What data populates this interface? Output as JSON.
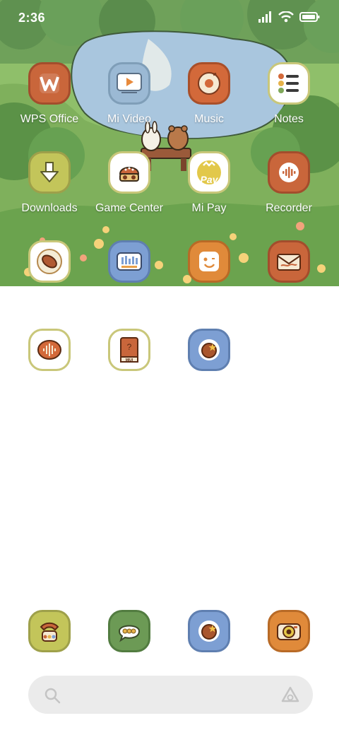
{
  "status": {
    "time": "2:36"
  },
  "apps": [
    {
      "label": "WPS Office",
      "icon": "wps-office-icon"
    },
    {
      "label": "Mi Video",
      "icon": "mi-video-icon"
    },
    {
      "label": "Music",
      "icon": "music-icon"
    },
    {
      "label": "Notes",
      "icon": "notes-icon"
    },
    {
      "label": "Downloads",
      "icon": "downloads-icon"
    },
    {
      "label": "Game Center",
      "icon": "game-center-icon"
    },
    {
      "label": "Mi Pay",
      "icon": "mi-pay-icon",
      "badge_text": "Pay"
    },
    {
      "label": "Recorder",
      "icon": "recorder-icon"
    },
    {
      "label": "",
      "icon": "bean-icon"
    },
    {
      "label": "",
      "icon": "equalizer-icon"
    },
    {
      "label": "",
      "icon": "smiley-icon"
    },
    {
      "label": "",
      "icon": "envelope-icon"
    },
    {
      "label": "",
      "icon": "voice-icon"
    },
    {
      "label": "",
      "icon": "miui-book-icon",
      "badge_text": "MIUI"
    },
    {
      "label": "",
      "icon": "cookie-star-icon"
    }
  ],
  "dock": [
    {
      "icon": "phone-icon"
    },
    {
      "icon": "messages-icon"
    },
    {
      "icon": "browser-icon"
    },
    {
      "icon": "camera-icon"
    }
  ],
  "search": {
    "icon": "search-icon",
    "assistant_icon": "assistant-icon"
  }
}
